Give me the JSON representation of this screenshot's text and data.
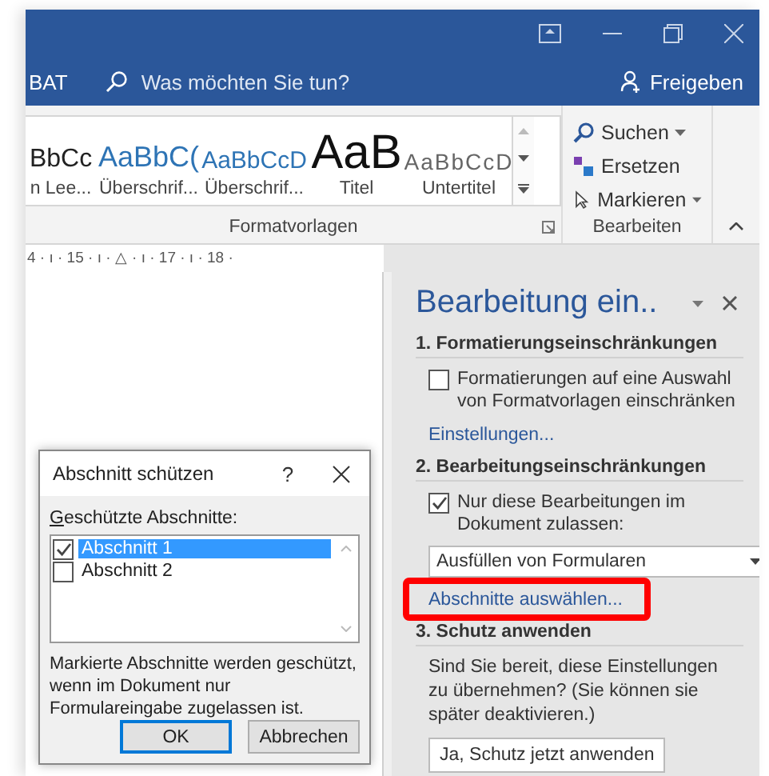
{
  "title_bar": {
    "tab_partial": "BAT",
    "tell_me": {
      "placeholder": "Was möchten Sie tun?"
    },
    "share": "Freigeben"
  },
  "styles_gallery": {
    "items": [
      {
        "sample": "BbCc",
        "label": "n Lee...",
        "kind": "normal"
      },
      {
        "sample": "AaBbC(",
        "label": "Überschrif...",
        "kind": "heading1"
      },
      {
        "sample": "AaBbCcD",
        "label": "Überschrif...",
        "kind": "heading2"
      },
      {
        "sample": "AaB",
        "label": "Titel",
        "kind": "title"
      },
      {
        "sample": "AaBbCcD",
        "label": "Untertitel",
        "kind": "subtitle"
      }
    ],
    "group": "Formatvorlagen"
  },
  "editing_group": {
    "items": [
      {
        "label": "Suchen",
        "kind": "search",
        "dropdown": true
      },
      {
        "label": "Ersetzen",
        "kind": "replace",
        "dropdown": false
      },
      {
        "label": "Markieren",
        "kind": "select",
        "dropdown": true
      }
    ],
    "group": "Bearbeiten"
  },
  "ruler": "4 · ı · 15 · ı · △ · ı · 17 · ı · 18 ·",
  "task_pane": {
    "title": "Bearbeitung ein..",
    "sections": [
      {
        "heading": "1. Formatierungseinschränkungen",
        "items": [
          {
            "kind": "checkbox",
            "label": "Formatierungen auf eine Auswahl von Formatvorlagen einschränken",
            "checked": false
          },
          {
            "kind": "link",
            "label": "Einstellungen...",
            "highlighted": false
          }
        ]
      },
      {
        "heading": "2. Bearbeitungseinschränkungen",
        "items": [
          {
            "kind": "checkbox",
            "label": "Nur diese Bearbeitungen im Dokument zulassen:",
            "checked": true
          },
          {
            "kind": "dropdown",
            "label": "Ausfüllen von Formularen"
          },
          {
            "kind": "link",
            "label": "Abschnitte auswählen...",
            "highlighted": true
          }
        ]
      },
      {
        "heading": "3. Schutz anwenden",
        "items": [
          {
            "kind": "text",
            "label": "Sind Sie bereit, diese Einstellungen zu übernehmen? (Sie können sie später deaktivieren.)"
          },
          {
            "kind": "button",
            "label": "Ja, Schutz jetzt anwenden"
          }
        ]
      }
    ]
  },
  "dialog": {
    "title": "Abschnitt schützen",
    "help": "?",
    "list_label": "Geschützte Abschnitte:",
    "sections": [
      {
        "label": "Abschnitt 1",
        "checked": true,
        "selected": true
      },
      {
        "label": "Abschnitt 2",
        "checked": false,
        "selected": false
      }
    ],
    "message": "Markierte Abschnitte werden geschützt, wenn im Dokument nur Formulareingabe zugelassen ist.",
    "buttons": [
      {
        "label": "OK",
        "default": true
      },
      {
        "label": "Abbrechen",
        "default": false
      }
    ]
  }
}
